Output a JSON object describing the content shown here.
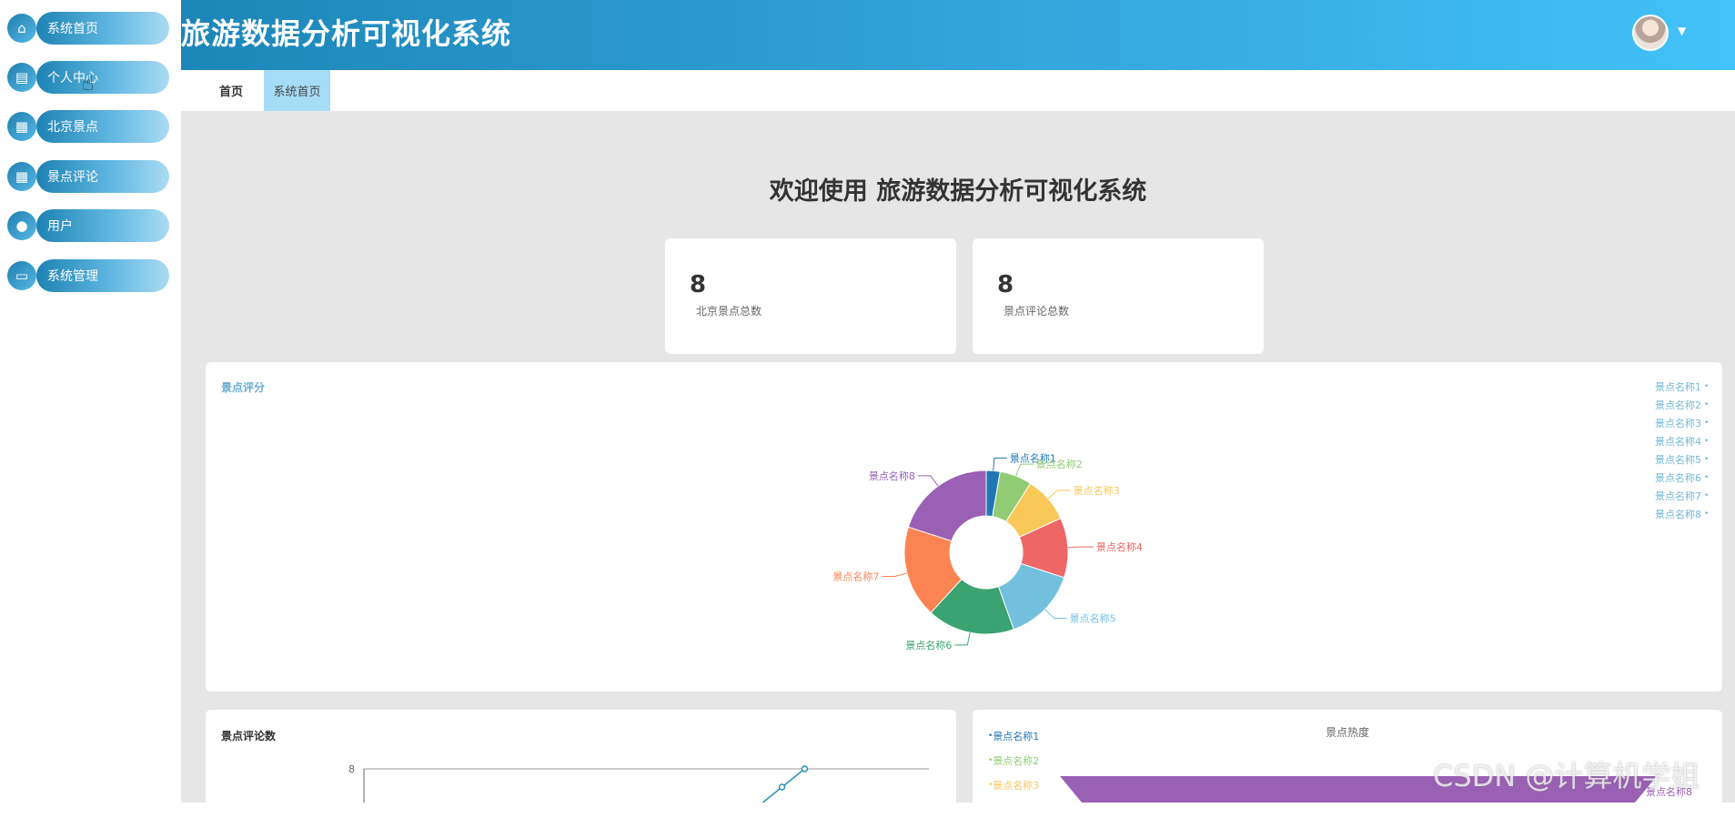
{
  "app": {
    "title": "旅游数据分析可视化系统"
  },
  "sidebar": {
    "items": [
      {
        "label": "系统首页",
        "icon": "home-icon",
        "glyph": "⌂"
      },
      {
        "label": "个人中心",
        "icon": "profile-card-icon",
        "glyph": "▤"
      },
      {
        "label": "北京景点",
        "icon": "grid-icon",
        "glyph": "▦"
      },
      {
        "label": "景点评论",
        "icon": "grid-icon",
        "glyph": "▦"
      },
      {
        "label": "用户",
        "icon": "user-icon",
        "glyph": "●"
      },
      {
        "label": "系统管理",
        "icon": "monitor-icon",
        "glyph": "▭"
      }
    ]
  },
  "tabs": [
    {
      "label": "首页"
    },
    {
      "label": "系统首页"
    }
  ],
  "main": {
    "welcome": "欢迎使用 旅游数据分析可视化系统",
    "stats": [
      {
        "value": "8",
        "label": "北京景点总数"
      },
      {
        "value": "8",
        "label": "景点评论总数"
      }
    ]
  },
  "panels": {
    "score": {
      "title": "景点评分"
    },
    "comments": {
      "title": "景点评论数"
    },
    "heat": {
      "title": "景点热度"
    }
  },
  "chart_data": [
    {
      "type": "pie",
      "title": "景点评分",
      "variant": "donut",
      "legend": "top-right",
      "categories": [
        "景点名称1",
        "景点名称2",
        "景点名称3",
        "景点名称4",
        "景点名称5",
        "景点名称6",
        "景点名称7",
        "景点名称8"
      ],
      "values": [
        3,
        7,
        10,
        13,
        16,
        19,
        20,
        22
      ],
      "colors": [
        "#1f77b4",
        "#91cc75",
        "#fac858",
        "#ee6666",
        "#73c0de",
        "#3ba272",
        "#fc8452",
        "#9a60b4"
      ]
    },
    {
      "type": "line",
      "title": "景点评论数",
      "y_tick_visible": 8,
      "x_visible_points": [
        [
          0.74,
          7.5
        ],
        [
          0.78,
          8
        ]
      ],
      "color": "#2d8fb5"
    },
    {
      "type": "funnel",
      "title": "景点热度",
      "legend": "top-left",
      "categories": [
        "景点名称1",
        "景点名称2",
        "景点名称3"
      ],
      "visible_bar_label": "景点名称8",
      "legend_colors": [
        "#1f77b4",
        "#91cc75",
        "#fac858"
      ],
      "bar_color": "#9a60b4"
    }
  ],
  "watermark": "CSDN @计算机学姐"
}
